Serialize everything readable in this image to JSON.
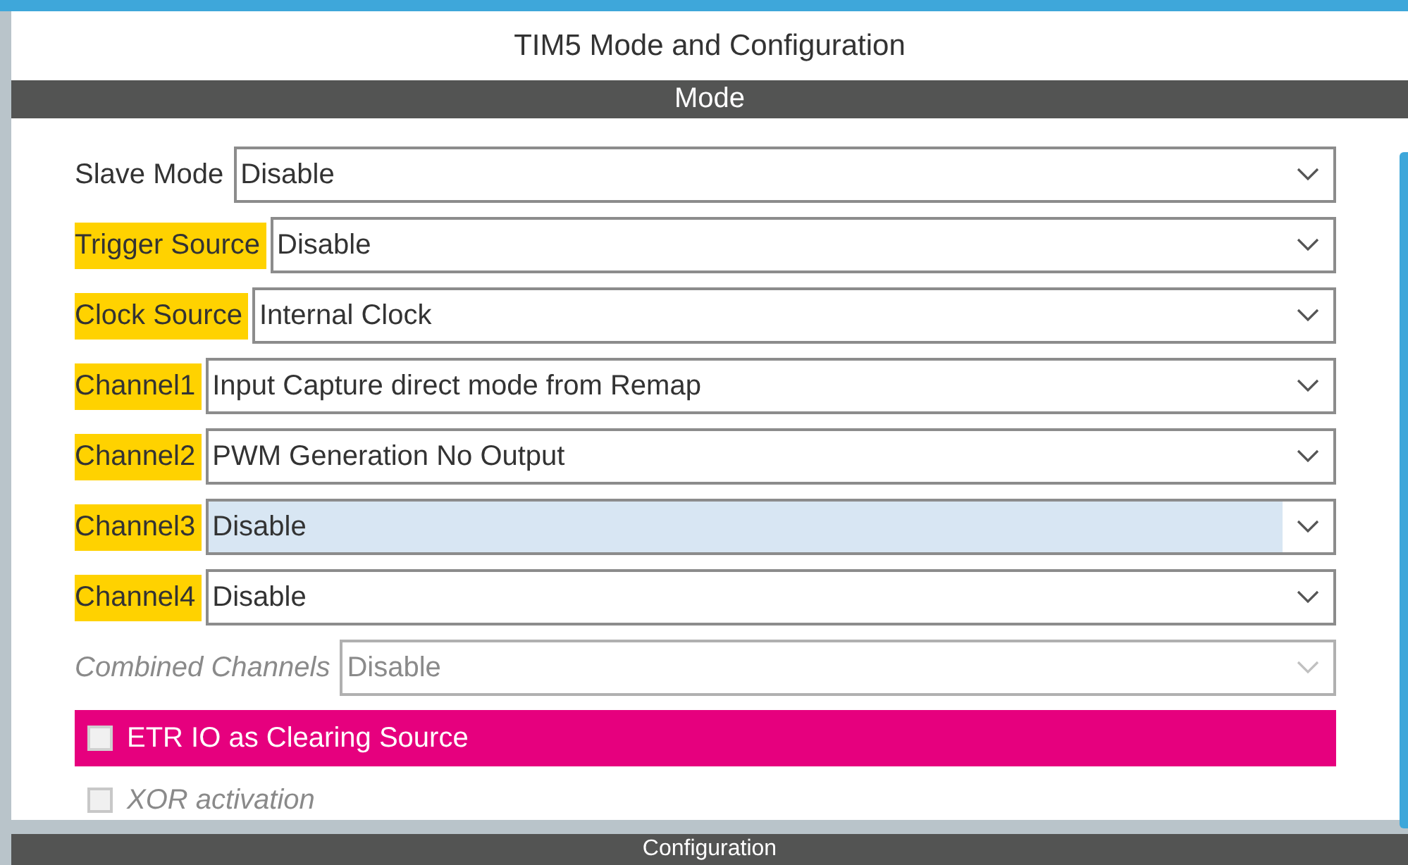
{
  "window": {
    "title": "TIM5 Mode and Configuration"
  },
  "mode_section": {
    "title": "Mode",
    "settings": [
      {
        "kind": "select",
        "label": "Slave Mode",
        "value": "Disable",
        "highlighted": false,
        "disabled": false,
        "hovered": false
      },
      {
        "kind": "select",
        "label": "Trigger Source",
        "value": "Disable",
        "highlighted": true,
        "disabled": false,
        "hovered": false
      },
      {
        "kind": "select",
        "label": "Clock Source",
        "value": "Internal Clock",
        "highlighted": true,
        "disabled": false,
        "hovered": false
      },
      {
        "kind": "select",
        "label": "Channel1",
        "value": "Input Capture direct mode from Remap",
        "highlighted": true,
        "disabled": false,
        "hovered": false
      },
      {
        "kind": "select",
        "label": "Channel2",
        "value": "PWM Generation No Output",
        "highlighted": true,
        "disabled": false,
        "hovered": false
      },
      {
        "kind": "select",
        "label": "Channel3",
        "value": "Disable",
        "highlighted": true,
        "disabled": false,
        "hovered": true
      },
      {
        "kind": "select",
        "label": "Channel4",
        "value": "Disable",
        "highlighted": true,
        "disabled": false,
        "hovered": false
      },
      {
        "kind": "select",
        "label": "Combined Channels",
        "value": "Disable",
        "highlighted": false,
        "disabled": true,
        "hovered": false
      },
      {
        "kind": "checkbox",
        "label": "ETR IO as Clearing Source",
        "checked": false,
        "highlighted": true,
        "disabled": false
      },
      {
        "kind": "checkbox",
        "label": "XOR activation",
        "checked": false,
        "highlighted": false,
        "disabled": true
      }
    ]
  },
  "configuration_section": {
    "title": "Configuration"
  }
}
